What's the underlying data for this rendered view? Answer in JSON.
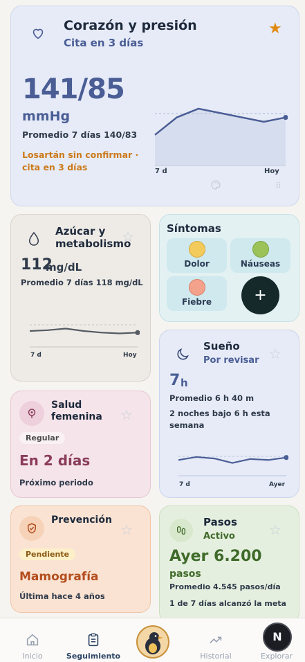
{
  "heart": {
    "title": "Corazón y presión",
    "subtitle": "Cita en 3 días",
    "value": "141/85",
    "unit": "mmHg",
    "avg": "Promedio 7 días 140/83",
    "warning_line1": "Losartán sin confirmar ·",
    "warning_line2": "cita en 3 días",
    "x_start": "7 d",
    "x_end": "Hoy",
    "chart_data": {
      "type": "line",
      "values": [
        137,
        141,
        143,
        142,
        141,
        140,
        141
      ]
    }
  },
  "sugar": {
    "title_line1": "Azúcar y",
    "title_line2": "metabolismo",
    "value": "112",
    "unit": "mg/dL",
    "avg": "Promedio 7 días 118 mg/dL",
    "x_start": "7 d",
    "x_end": "Hoy",
    "chart_data": {
      "type": "line",
      "values": [
        118,
        119,
        121,
        118,
        116,
        115,
        116
      ]
    }
  },
  "symptoms": {
    "title": "Síntomas",
    "items": [
      {
        "label": "Dolor",
        "icon": "worried-face-icon"
      },
      {
        "label": "Náuseas",
        "icon": "nauseated-face-icon"
      },
      {
        "label": "Fiebre",
        "icon": "feverish-face-icon"
      }
    ],
    "add_label": "+"
  },
  "sleep": {
    "title": "Sueño",
    "subtitle": "Por revisar",
    "value": "7",
    "unit": "h",
    "avg": "Promedio 6 h 40 m",
    "note_line1": "2 noches bajo 6 h esta",
    "note_line2": "semana",
    "x_start": "7 d",
    "x_end": "Ayer",
    "chart_data": {
      "type": "line",
      "values": [
        6.6,
        7.2,
        6.9,
        6.0,
        6.8,
        6.6,
        7.1
      ]
    }
  },
  "feminine": {
    "title_line1": "Salud",
    "title_line2": "femenina",
    "badge": "Regular",
    "value": "En 2 días",
    "caption": "Próximo periodo"
  },
  "prevention": {
    "title": "Prevención",
    "badge": "Pendiente",
    "value": "Mamografía",
    "caption": "Última hace 4 años"
  },
  "steps": {
    "title": "Pasos",
    "subtitle": "Activo",
    "value": "Ayer 6.200",
    "unit": "pasos",
    "avg": "Promedio 4.545 pasos/día",
    "note": "1 de 7 días alcanzó la meta"
  },
  "nav": {
    "items": [
      {
        "label": "Inicio",
        "icon": "home-icon"
      },
      {
        "label": "Seguimiento",
        "icon": "clipboard-icon"
      },
      {
        "label": "",
        "icon": "bird-avatar-icon"
      },
      {
        "label": "Historial",
        "icon": "trend-icon"
      },
      {
        "label": "Explorar",
        "icon": "explore-icon"
      }
    ],
    "badge_letter": "N"
  },
  "colors": {
    "primary": "#4a5d95",
    "warning": "#cc7a1a",
    "sugar": "#2f3a4a",
    "feminine": "#8b3c5a",
    "prevention": "#b34e1e",
    "steps": "#3f6b2a",
    "star": "#e08a12"
  }
}
